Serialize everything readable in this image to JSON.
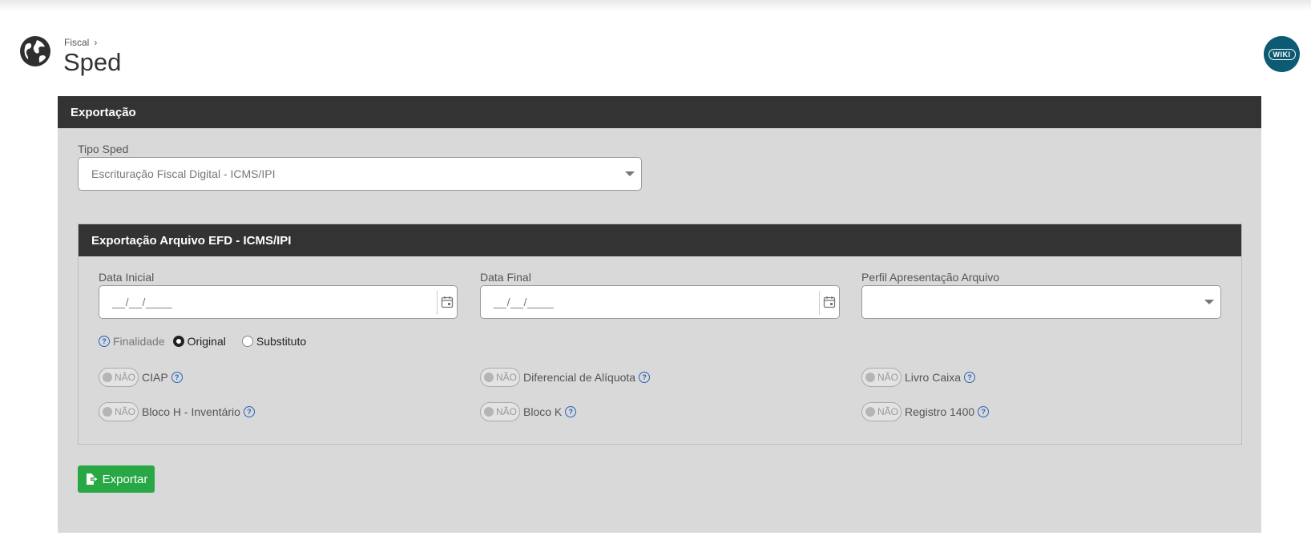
{
  "breadcrumb": {
    "parent": "Fiscal"
  },
  "page": {
    "title": "Sped"
  },
  "wiki": {
    "label": "WIKI"
  },
  "panel": {
    "title": "Exportação",
    "tipo_sped": {
      "label": "Tipo Sped",
      "value": "Escrituração Fiscal Digital - ICMS/IPI"
    }
  },
  "subpanel": {
    "title": "Exportação Arquivo EFD - ICMS/IPI",
    "data_inicial": {
      "label": "Data Inicial",
      "value": "__/__/____"
    },
    "data_final": {
      "label": "Data Final",
      "value": "__/__/____"
    },
    "perfil": {
      "label": "Perfil Apresentação Arquivo",
      "value": ""
    },
    "finalidade": {
      "label": "Finalidade",
      "options": [
        {
          "label": "Original",
          "checked": true
        },
        {
          "label": "Substituto",
          "checked": false
        }
      ]
    },
    "toggles": [
      {
        "label": "CIAP",
        "state": "NÃO"
      },
      {
        "label": "Diferencial de Alíquota",
        "state": "NÃO"
      },
      {
        "label": "Livro Caixa",
        "state": "NÃO"
      },
      {
        "label": "Bloco H - Inventário",
        "state": "NÃO"
      },
      {
        "label": "Bloco K",
        "state": "NÃO"
      },
      {
        "label": "Registro 1400",
        "state": "NÃO"
      }
    ]
  },
  "export_button": {
    "label": "Exportar"
  },
  "colors": {
    "header_bg": "#333333",
    "panel_bg": "#d9d9d9",
    "button_green": "#28a745",
    "help_blue": "#2563b8",
    "wiki_bg": "#0d5a73"
  }
}
